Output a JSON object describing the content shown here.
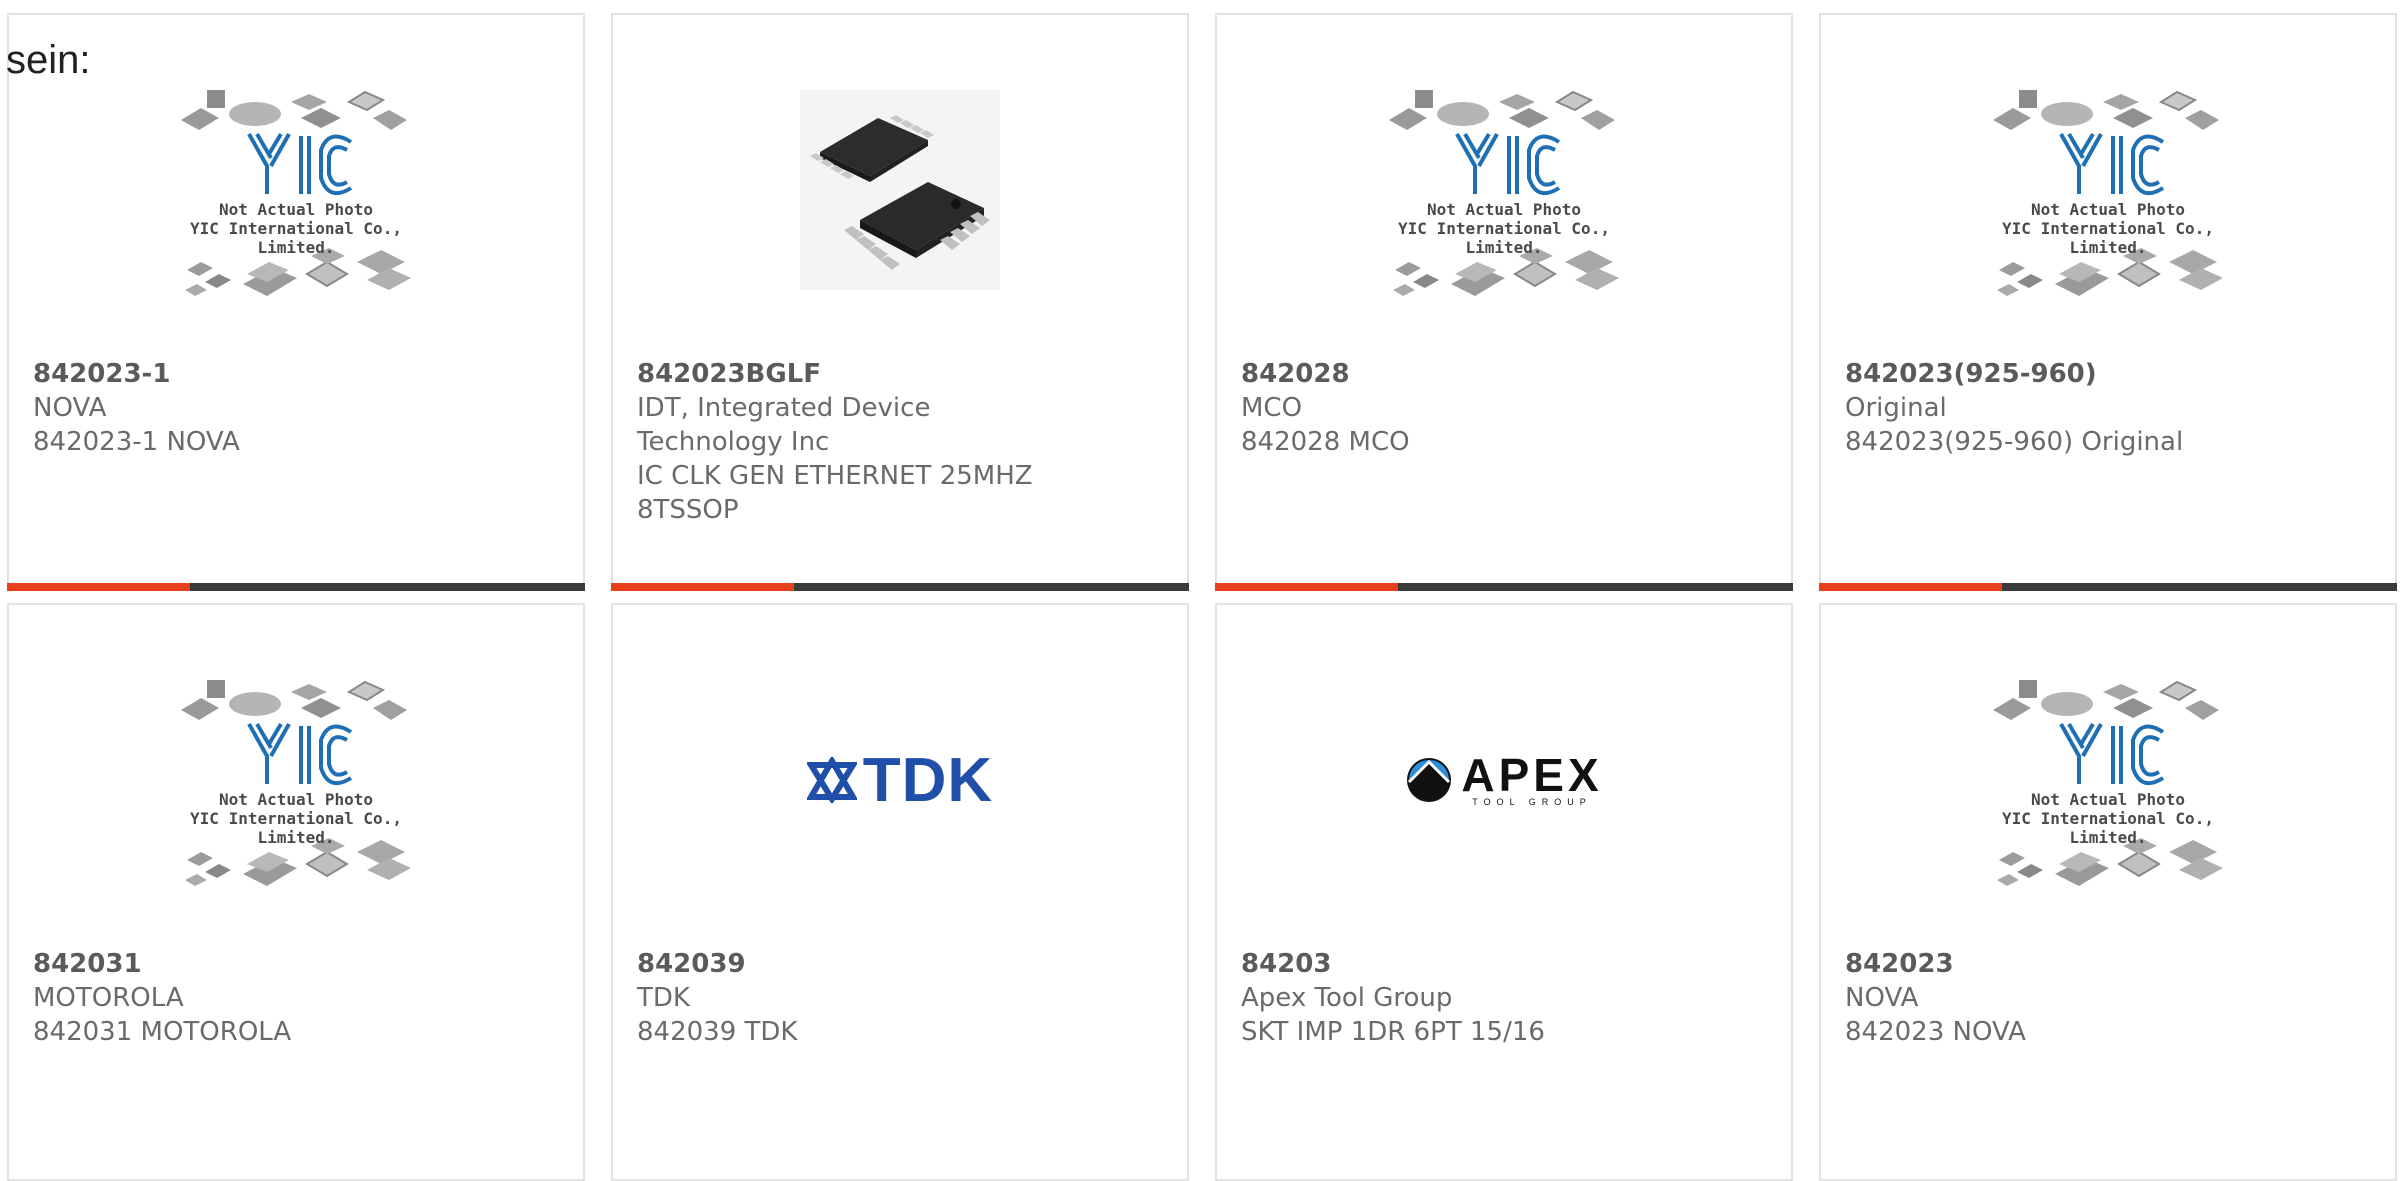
{
  "lead_text": "sein:",
  "placeholder": {
    "caption_line1": "Not Actual Photo",
    "caption_line2": "YIC International Co., Limited."
  },
  "logos": {
    "tdk": "TDK",
    "apex": "APEX",
    "apex_sub": "TOOL GROUP"
  },
  "products": [
    {
      "part": "842023-1",
      "lines": [
        "NOVA",
        "842023-1 NOVA"
      ]
    },
    {
      "part": "842023BGLF",
      "lines": [
        "IDT, Integrated Device",
        "Technology Inc",
        "IC CLK GEN ETHERNET 25MHZ",
        "8TSSOP"
      ]
    },
    {
      "part": "842028",
      "lines": [
        "MCO",
        "842028 MCO"
      ]
    },
    {
      "part": "842023(925-960)",
      "lines": [
        "Original",
        "842023(925-960) Original"
      ]
    },
    {
      "part": "842031",
      "lines": [
        "MOTOROLA",
        "842031 MOTOROLA"
      ]
    },
    {
      "part": "842039",
      "lines": [
        "TDK",
        "842039 TDK"
      ]
    },
    {
      "part": "84203",
      "lines": [
        "Apex Tool Group",
        "SKT IMP 1DR 6PT 15/16"
      ]
    },
    {
      "part": "842023",
      "lines": [
        "NOVA",
        "842023 NOVA"
      ]
    }
  ],
  "colors": {
    "accent": "#e8401c",
    "bar": "#3b3b3b",
    "yic_logo": "#1f6fb5",
    "tdk_logo": "#1f4fa8"
  }
}
